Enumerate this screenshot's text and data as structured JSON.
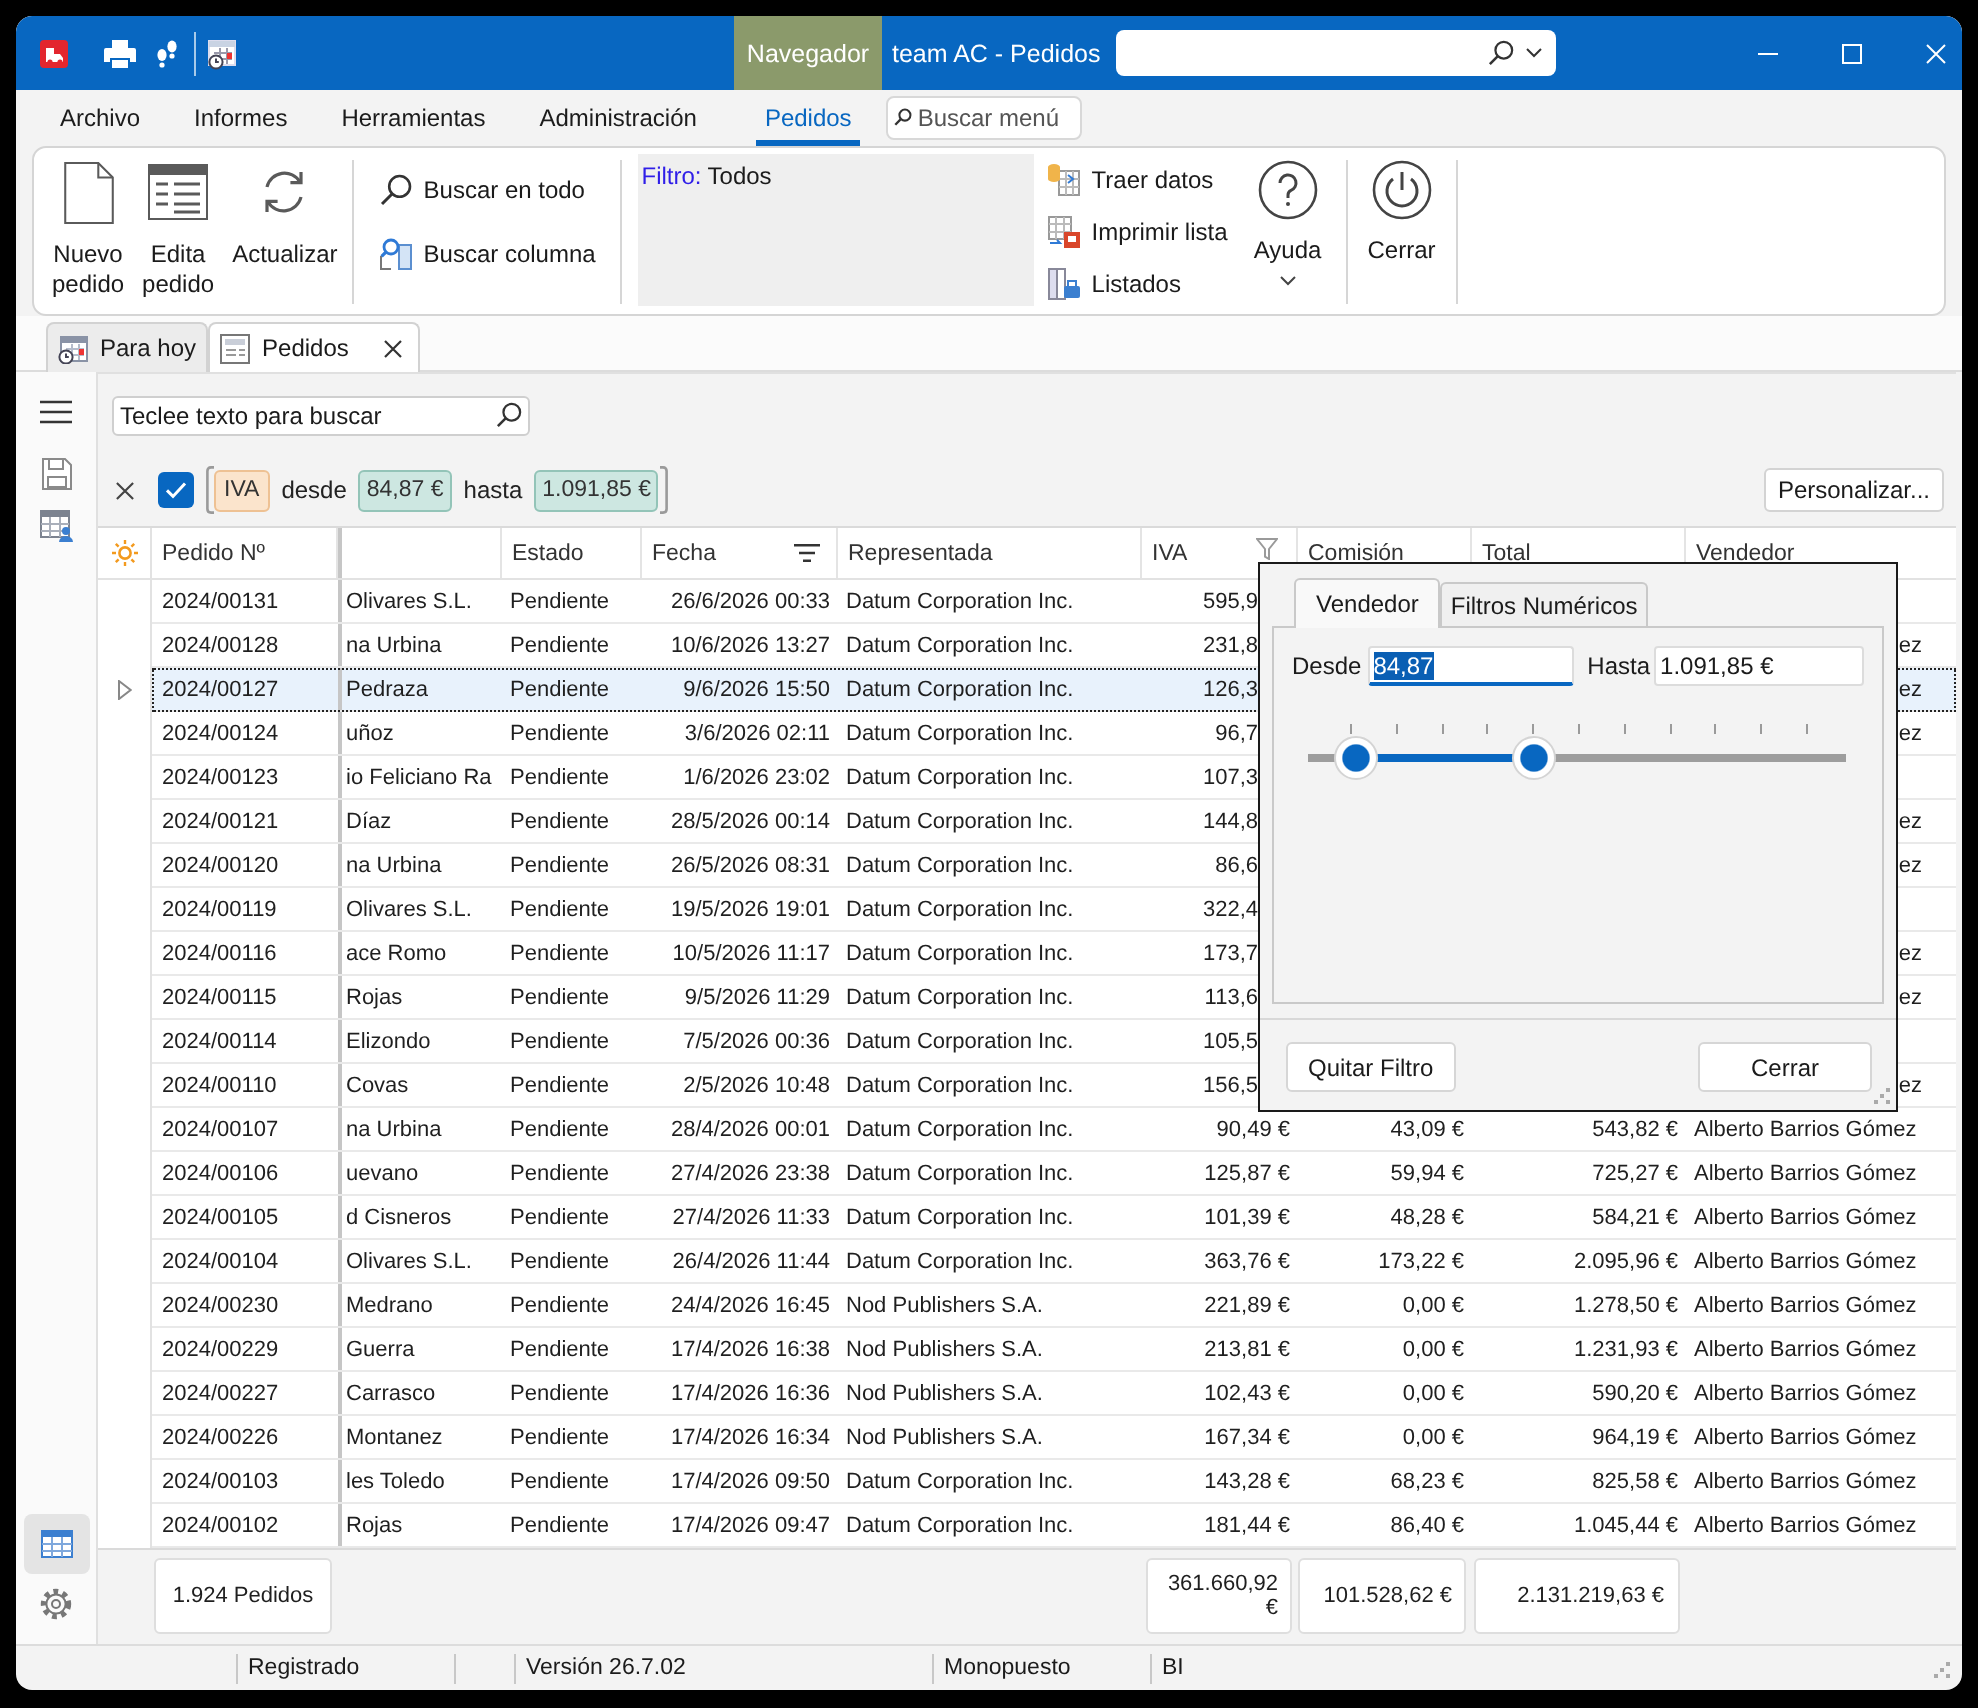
{
  "title_bar": {
    "navigator": "Navegador",
    "title": "team AC - Pedidos"
  },
  "menu": {
    "items": [
      {
        "label": "Archivo",
        "selected": false
      },
      {
        "label": "Informes",
        "selected": false
      },
      {
        "label": "Herramientas",
        "selected": false
      },
      {
        "label": "Administración",
        "selected": false
      },
      {
        "label": "Pedidos",
        "selected": true
      }
    ],
    "search": {
      "placeholder": "Buscar menú"
    }
  },
  "ribbon": {
    "large_buttons": [
      {
        "kind": "new",
        "label": "Nuevo pedido"
      },
      {
        "kind": "edit",
        "label": "Edita pedido"
      },
      {
        "kind": "refresh",
        "label": "Actualizar"
      }
    ],
    "search_buttons": [
      {
        "kind": "search_all",
        "label": "Buscar en todo"
      },
      {
        "kind": "search_column",
        "label": "Buscar columna"
      }
    ],
    "filter": {
      "label": "Filtro:",
      "value": "Todos"
    },
    "list_buttons": [
      {
        "kind": "fetch",
        "label": "Traer datos"
      },
      {
        "kind": "print",
        "label": "Imprimir lista"
      },
      {
        "kind": "reports",
        "label": "Listados"
      }
    ],
    "help_button": {
      "label": "Ayuda"
    },
    "close_button": {
      "label": "Cerrar"
    }
  },
  "document_tabs": [
    {
      "kind": "calendar",
      "label": "Para hoy",
      "selected": false,
      "closable": false
    },
    {
      "kind": "form",
      "label": "Pedidos",
      "selected": true,
      "closable": true
    }
  ],
  "sidebar": {
    "bottom_items": [
      {
        "kind": "table",
        "selected": true
      },
      {
        "kind": "settings",
        "selected": false
      }
    ]
  },
  "search": {
    "placeholder": "Teclee texto para buscar"
  },
  "filter_bar": {
    "checked": true,
    "field": "IVA",
    "from_label": "desde",
    "from_value": "84,87 €",
    "to_label": "hasta",
    "to_value": "1.091,85 €",
    "customize_button": "Personalizar..."
  },
  "table": {
    "columns": [
      {
        "label": "Pedido Nº",
        "sorted": false,
        "filtered": false
      },
      {
        "sorted": false,
        "filtered": false
      },
      {
        "label": "Estado",
        "sorted": false,
        "filtered": false
      },
      {
        "label": "Fecha",
        "sorted": true,
        "filtered": false
      },
      {
        "label": "Representada",
        "sorted": false,
        "filtered": false
      },
      {
        "label": "IVA",
        "sorted": false,
        "filtered": true
      },
      {
        "label": "Comisión",
        "sorted": false,
        "filtered": false
      },
      {
        "label": "Total",
        "sorted": false,
        "filtered": false
      },
      {
        "label": "Vendedor",
        "sorted": false,
        "filtered": false
      }
    ],
    "rows": [
      {
        "selected": false,
        "pedido_n": "2024/00131",
        "column_2": "Olivares S.L.",
        "estado": "Pendiente",
        "fecha": "26/6/2026 00:33",
        "representada": "Datum Corporation Inc.",
        "iva": "595,9"
      },
      {
        "selected": false,
        "pedido_n": "2024/00128",
        "column_2": "na Urbina",
        "estado": "Pendiente",
        "fecha": "10/6/2026 13:27",
        "representada": "Datum Corporation Inc.",
        "iva": "231,8",
        "vendedor": "ez"
      },
      {
        "selected": true,
        "pedido_n": "2024/00127",
        "column_2": "Pedraza",
        "estado": "Pendiente",
        "fecha": "9/6/2026 15:50",
        "representada": "Datum Corporation Inc.",
        "iva": "126,3",
        "vendedor": "ez"
      },
      {
        "selected": false,
        "pedido_n": "2024/00124",
        "column_2": "uñoz",
        "estado": "Pendiente",
        "fecha": "3/6/2026 02:11",
        "representada": "Datum Corporation Inc.",
        "iva": "96,7",
        "vendedor": "ez"
      },
      {
        "selected": false,
        "pedido_n": "2024/00123",
        "column_2": "io Feliciano Ra",
        "estado": "Pendiente",
        "fecha": "1/6/2026 23:02",
        "representada": "Datum Corporation Inc.",
        "iva": "107,3"
      },
      {
        "selected": false,
        "pedido_n": "2024/00121",
        "column_2": "Díaz",
        "estado": "Pendiente",
        "fecha": "28/5/2026 00:14",
        "representada": "Datum Corporation Inc.",
        "iva": "144,8",
        "vendedor": "ez"
      },
      {
        "selected": false,
        "pedido_n": "2024/00120",
        "column_2": "na Urbina",
        "estado": "Pendiente",
        "fecha": "26/5/2026 08:31",
        "representada": "Datum Corporation Inc.",
        "iva": "86,6",
        "vendedor": "ez"
      },
      {
        "selected": false,
        "pedido_n": "2024/00119",
        "column_2": "Olivares S.L.",
        "estado": "Pendiente",
        "fecha": "19/5/2026 19:01",
        "representada": "Datum Corporation Inc.",
        "iva": "322,4"
      },
      {
        "selected": false,
        "pedido_n": "2024/00116",
        "column_2": "ace Romo",
        "estado": "Pendiente",
        "fecha": "10/5/2026 11:17",
        "representada": "Datum Corporation Inc.",
        "iva": "173,7",
        "vendedor": "ez"
      },
      {
        "selected": false,
        "pedido_n": "2024/00115",
        "column_2": "Rojas",
        "estado": "Pendiente",
        "fecha": "9/5/2026 11:29",
        "representada": "Datum Corporation Inc.",
        "iva": "113,6",
        "vendedor": "ez"
      },
      {
        "selected": false,
        "pedido_n": "2024/00114",
        "column_2": "Elizondo",
        "estado": "Pendiente",
        "fecha": "7/5/2026 00:36",
        "representada": "Datum Corporation Inc.",
        "iva": "105,5"
      },
      {
        "selected": false,
        "pedido_n": "2024/00110",
        "column_2": "Covas",
        "estado": "Pendiente",
        "fecha": "2/5/2026 10:48",
        "representada": "Datum Corporation Inc.",
        "iva": "156,5",
        "vendedor": "ez"
      },
      {
        "selected": false,
        "pedido_n": "2024/00107",
        "column_2": "na Urbina",
        "estado": "Pendiente",
        "fecha": "28/4/2026 00:01",
        "representada": "Datum Corporation Inc.",
        "iva": "90,49 €",
        "comision": "43,09 €",
        "total": "543,82 €",
        "vendedor": "Alberto Barrios Gómez"
      },
      {
        "selected": false,
        "pedido_n": "2024/00106",
        "column_2": "uevano",
        "estado": "Pendiente",
        "fecha": "27/4/2026 23:38",
        "representada": "Datum Corporation Inc.",
        "iva": "125,87 €",
        "comision": "59,94 €",
        "total": "725,27 €",
        "vendedor": "Alberto Barrios Gómez"
      },
      {
        "selected": false,
        "pedido_n": "2024/00105",
        "column_2": "d Cisneros",
        "estado": "Pendiente",
        "fecha": "27/4/2026 11:33",
        "representada": "Datum Corporation Inc.",
        "iva": "101,39 €",
        "comision": "48,28 €",
        "total": "584,21 €",
        "vendedor": "Alberto Barrios Gómez"
      },
      {
        "selected": false,
        "pedido_n": "2024/00104",
        "column_2": "Olivares S.L.",
        "estado": "Pendiente",
        "fecha": "26/4/2026 11:44",
        "representada": "Datum Corporation Inc.",
        "iva": "363,76 €",
        "comision": "173,22 €",
        "total": "2.095,96 €",
        "vendedor": "Alberto Barrios Gómez"
      },
      {
        "selected": false,
        "pedido_n": "2024/00230",
        "column_2": "Medrano",
        "estado": "Pendiente",
        "fecha": "24/4/2026 16:45",
        "representada": "Nod Publishers S.A.",
        "iva": "221,89 €",
        "comision": "0,00 €",
        "total": "1.278,50 €",
        "vendedor": "Alberto Barrios Gómez"
      },
      {
        "selected": false,
        "pedido_n": "2024/00229",
        "column_2": "Guerra",
        "estado": "Pendiente",
        "fecha": "17/4/2026 16:38",
        "representada": "Nod Publishers S.A.",
        "iva": "213,81 €",
        "comision": "0,00 €",
        "total": "1.231,93 €",
        "vendedor": "Alberto Barrios Gómez"
      },
      {
        "selected": false,
        "pedido_n": "2024/00227",
        "column_2": "Carrasco",
        "estado": "Pendiente",
        "fecha": "17/4/2026 16:36",
        "representada": "Nod Publishers S.A.",
        "iva": "102,43 €",
        "comision": "0,00 €",
        "total": "590,20 €",
        "vendedor": "Alberto Barrios Gómez"
      },
      {
        "selected": false,
        "pedido_n": "2024/00226",
        "column_2": "Montanez",
        "estado": "Pendiente",
        "fecha": "17/4/2026 16:34",
        "representada": "Nod Publishers S.A.",
        "iva": "167,34 €",
        "comision": "0,00 €",
        "total": "964,19 €",
        "vendedor": "Alberto Barrios Gómez"
      },
      {
        "selected": false,
        "pedido_n": "2024/00103",
        "column_2": "les Toledo",
        "estado": "Pendiente",
        "fecha": "17/4/2026 09:50",
        "representada": "Datum Corporation Inc.",
        "iva": "143,28 €",
        "comision": "68,23 €",
        "total": "825,58 €",
        "vendedor": "Alberto Barrios Gómez"
      },
      {
        "selected": false,
        "pedido_n": "2024/00102",
        "column_2": "Rojas",
        "estado": "Pendiente",
        "fecha": "17/4/2026 09:47",
        "representada": "Datum Corporation Inc.",
        "iva": "181,44 €",
        "comision": "86,40 €",
        "total": "1.045,44 €",
        "vendedor": "Alberto Barrios Gómez"
      }
    ]
  },
  "summary": {
    "count": "1.924 Pedidos",
    "iva_total": "361.660,92 €",
    "comision_total": "101.528,62 €",
    "total": "2.131.219,63 €"
  },
  "status_bar": {
    "items": [
      "Registrado",
      "Versión 26.7.02",
      "Monopuesto",
      "BI"
    ]
  },
  "filter_popup": {
    "tabs": [
      {
        "label": "Vendedor",
        "selected": true
      },
      {
        "label": "Filtros Numéricos",
        "selected": false
      }
    ],
    "from": {
      "label": "Desde",
      "value": "84,87",
      "focused": true
    },
    "to": {
      "label": "Hasta",
      "value": "1.091,85 €",
      "focused": false
    },
    "range_slider": {
      "thumbs": [
        {
          "level": 0.09
        },
        {
          "level": 0.42
        }
      ]
    },
    "buttons": [
      "Quitar Filtro",
      "Cerrar"
    ]
  }
}
